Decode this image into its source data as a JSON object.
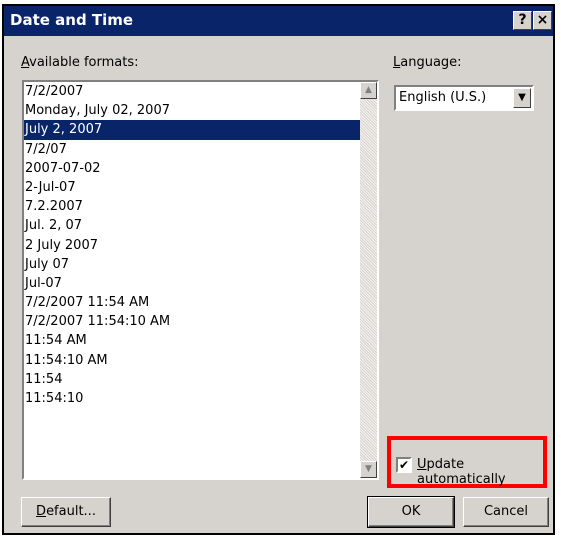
{
  "window": {
    "title": "Date and Time",
    "help_label": "?",
    "close_label": "×"
  },
  "formats": {
    "label_accel": "A",
    "label_rest": "vailable formats:",
    "items": [
      "7/2/2007",
      "Monday, July 02, 2007",
      "July 2, 2007",
      "7/2/07",
      "2007-07-02",
      "2-Jul-07",
      "7.2.2007",
      "Jul. 2, 07",
      "2 July 2007",
      "July 07",
      "Jul-07",
      "7/2/2007 11:54 AM",
      "7/2/2007 11:54:10 AM",
      "11:54 AM",
      "11:54:10 AM",
      "11:54",
      "11:54:10"
    ],
    "selected_index": 2
  },
  "language": {
    "label_accel": "L",
    "label_rest": "anguage:",
    "value": "English (U.S.)"
  },
  "update": {
    "checked": true,
    "check_mark": "✔",
    "label_accel": "U",
    "label_rest": "pdate automatically"
  },
  "buttons": {
    "default_accel": "D",
    "default_rest": "efault...",
    "ok": "OK",
    "cancel": "Cancel"
  },
  "icons": {
    "scroll_up": "up-arrow-icon",
    "scroll_down": "down-arrow-icon",
    "dropdown": "chevron-down-icon"
  },
  "colors": {
    "titlebar": "#0a246a",
    "dialog_bg": "#d6d3ce",
    "highlight": "#ff0000"
  }
}
